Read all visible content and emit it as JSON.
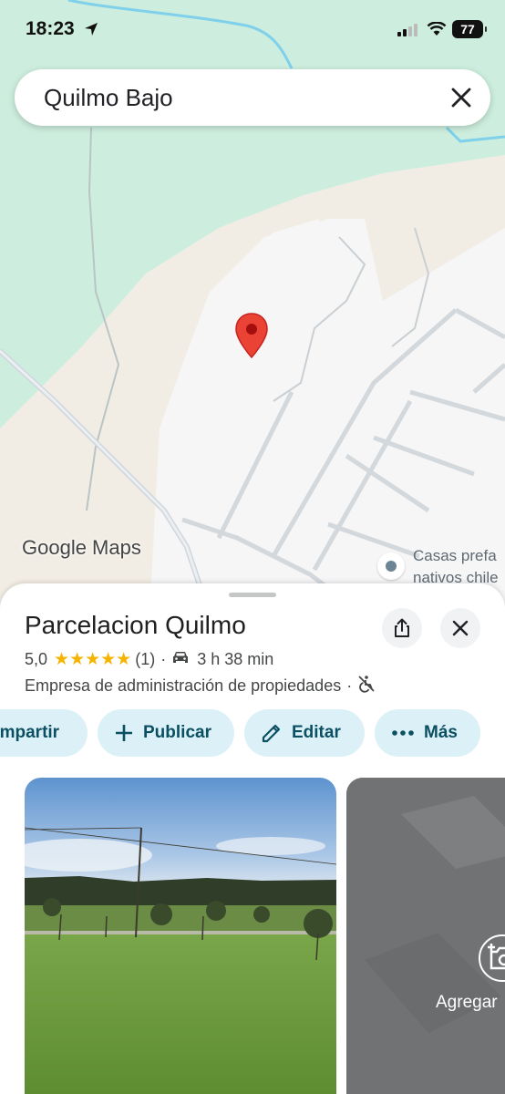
{
  "status_bar": {
    "time": "18:23",
    "battery": "77"
  },
  "search": {
    "query": "Quilmo Bajo"
  },
  "map": {
    "watermark": "Google Maps",
    "poi_label_line1": "Casas prefa",
    "poi_label_line2": "nativos chile"
  },
  "place": {
    "title": "Parcelacion Quilmo",
    "rating": "5,0",
    "stars": "★★★★★",
    "review_count": "(1)",
    "separator": "·",
    "drive_time": "3 h 38 min",
    "category": "Empresa de administración de propiedades",
    "category_separator": "·"
  },
  "actions": {
    "compartir": "ompartir",
    "publicar": "Publicar",
    "editar": "Editar",
    "mas": "Más"
  },
  "photos": {
    "add_label": "Agregar"
  },
  "colors": {
    "green_area": "#cdeede",
    "beige_area": "#f2ede4",
    "chip_bg": "#dcf1f7",
    "chip_text": "#0b4f63",
    "pin_red": "#ea4335",
    "star": "#f5b400"
  }
}
